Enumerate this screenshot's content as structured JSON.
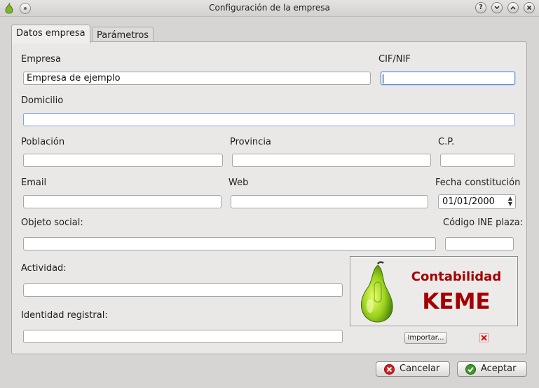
{
  "window": {
    "title": "Configuración de la empresa",
    "help_label": "?",
    "minimize_label": "⌄",
    "maximize_label": "⌃",
    "close_label": "×"
  },
  "tabs": [
    {
      "label": "Datos empresa",
      "active": true
    },
    {
      "label": "Parámetros",
      "active": false
    }
  ],
  "form": {
    "empresa": {
      "label": "Empresa",
      "value": "Empresa de ejemplo"
    },
    "cif": {
      "label": "CIF/NIF",
      "value": ""
    },
    "domicilio": {
      "label": "Domicilio",
      "value": ""
    },
    "poblacion": {
      "label": "Población",
      "value": ""
    },
    "provincia": {
      "label": "Provincia",
      "value": ""
    },
    "cp": {
      "label": "C.P.",
      "value": ""
    },
    "email": {
      "label": "Email",
      "value": ""
    },
    "web": {
      "label": "Web",
      "value": ""
    },
    "fecha": {
      "label": "Fecha constitución",
      "value": "01/01/2000"
    },
    "objeto": {
      "label": "Objeto social:",
      "value": ""
    },
    "ine": {
      "label": "Código INE plaza:",
      "value": ""
    },
    "actividad": {
      "label": "Actividad:",
      "value": ""
    },
    "identidad": {
      "label": "Identidad registral:",
      "value": ""
    }
  },
  "logo": {
    "line1": "Contabilidad",
    "line2": "KEME",
    "color": "#a40000"
  },
  "logo_actions": {
    "import_label": "Importar...",
    "delete_icon": "delete-x-icon"
  },
  "buttons": {
    "cancel_label": "Cancelar",
    "accept_label": "Aceptar"
  }
}
